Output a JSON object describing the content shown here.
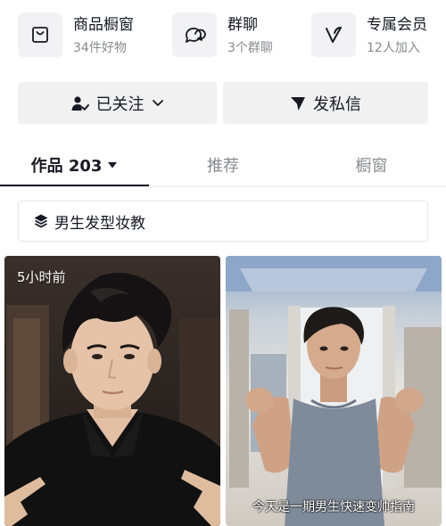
{
  "shortcuts": [
    {
      "title": "商品橱窗",
      "subtitle": "34件好物",
      "icon": "shopping-bag-icon"
    },
    {
      "title": "群聊",
      "subtitle": "3个群聊",
      "icon": "group-chat-icon"
    },
    {
      "title": "专属会员",
      "subtitle": "12人加入",
      "icon": "vip-v-icon"
    }
  ],
  "actions": {
    "follow_label": "已关注",
    "message_label": "发私信"
  },
  "tabs": [
    {
      "label": "作品 203"
    },
    {
      "label": "推荐"
    },
    {
      "label": "橱窗"
    }
  ],
  "collection": {
    "label": "男生发型妆教",
    "icon": "stack-layers-icon"
  },
  "videos": [
    {
      "badge": "5小时前",
      "caption": ""
    },
    {
      "badge": "",
      "caption": "今天是一期男生快速变帅指南"
    }
  ],
  "colors": {
    "text_primary": "#161823",
    "text_secondary": "#8a8b91",
    "button_bg": "#f1f1f2"
  }
}
